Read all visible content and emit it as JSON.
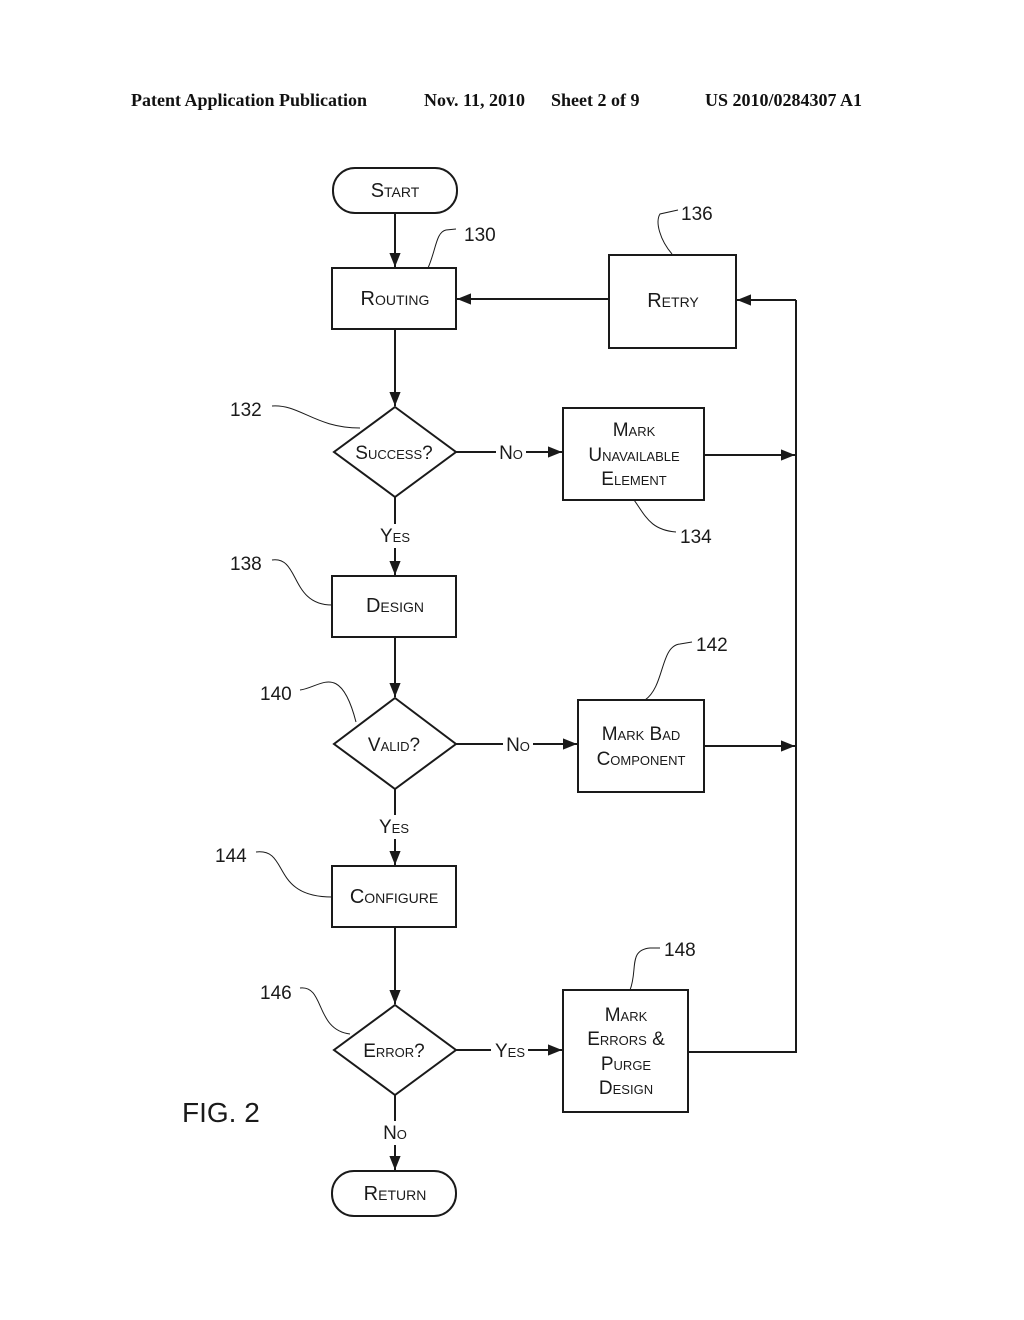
{
  "header": {
    "publication": "Patent Application Publication",
    "date": "Nov. 11, 2010",
    "sheet": "Sheet 2 of 9",
    "number": "US 2010/0284307 A1"
  },
  "figure_label": "FIG. 2",
  "nodes": {
    "start": {
      "label": "Start"
    },
    "routing": {
      "label": "Routing",
      "ref": "130"
    },
    "success": {
      "label": "Success?",
      "ref": "132"
    },
    "mark_unavailable": {
      "lines": [
        "Mark",
        "Unavailable",
        "Element"
      ],
      "ref": "134"
    },
    "retry": {
      "label": "Retry",
      "ref": "136"
    },
    "design": {
      "label": "Design",
      "ref": "138"
    },
    "valid": {
      "label": "Valid?",
      "ref": "140"
    },
    "mark_bad": {
      "lines": [
        "Mark Bad",
        "Component"
      ],
      "ref": "142"
    },
    "configure": {
      "label": "Configure",
      "ref": "144"
    },
    "error": {
      "label": "Error?",
      "ref": "146"
    },
    "mark_errors": {
      "lines": [
        "Mark",
        "Errors &",
        "Purge",
        "Design"
      ],
      "ref": "148"
    },
    "return": {
      "label": "Return"
    }
  },
  "edge_labels": {
    "success_no": "No",
    "success_yes": "Yes",
    "valid_no": "No",
    "valid_yes": "Yes",
    "error_yes": "Yes",
    "error_no": "No"
  }
}
